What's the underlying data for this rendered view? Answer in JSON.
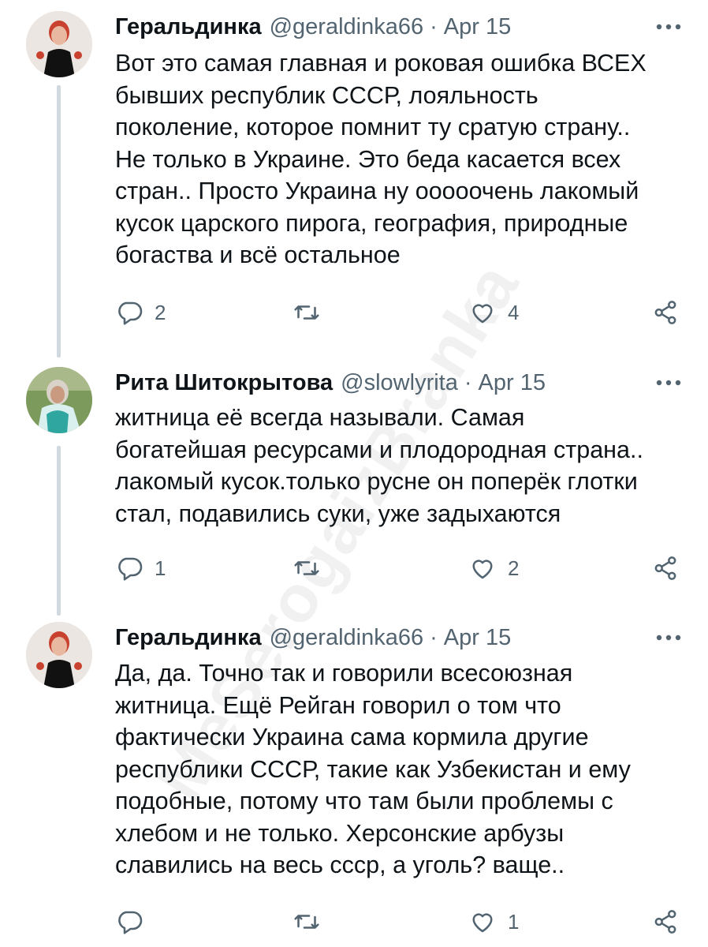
{
  "watermark": "MeSerogaizBranka",
  "tweets": [
    {
      "name": "Геральдинка",
      "handle": "@geraldinka66",
      "separator": "·",
      "date": "Apr 15",
      "text": "Вот это самая главная и роковая ошибка ВСЕХ\nбывших республик СССР, лояльность\nпоколение, которое помнит ту сратую страну..\nНе только в Украине. Это беда касается всех\nстран.. Просто Украина ну ооооочень лакомый\nкусок царского пирога, география, природные\nбогаства и всё остальное",
      "replies": "2",
      "retweets": "",
      "likes": "4"
    },
    {
      "name": "Рита Шитокрытова",
      "handle": "@slowlyrita",
      "separator": "·",
      "date": "Apr 15",
      "text": "житница её всегда называли. Самая\nбогатейшая ресурсами и плодородная страна..\nлакомый кусок.только русне он поперёк глотки\nстал, подавились суки, уже задыхаются",
      "replies": "1",
      "retweets": "",
      "likes": "2"
    },
    {
      "name": "Геральдинка",
      "handle": "@geraldinka66",
      "separator": "·",
      "date": "Apr 15",
      "text": "Да, да. Точно так и говорили всесоюзная\nжитница. Ещё Рейган говорил о том что\nфактически Украина сама кормила другие\nреспублики СССР, такие как Узбекистан и ему\nподобные, потому что там были проблемы с\nхлебом и не только. Херсонские арбузы\nславились на весь ссср, а уголь? ваще..",
      "replies": "",
      "retweets": "",
      "likes": "1"
    }
  ],
  "colors": {
    "text": "#0f1419",
    "secondary": "#536471",
    "thread_line": "#cfd9de"
  }
}
